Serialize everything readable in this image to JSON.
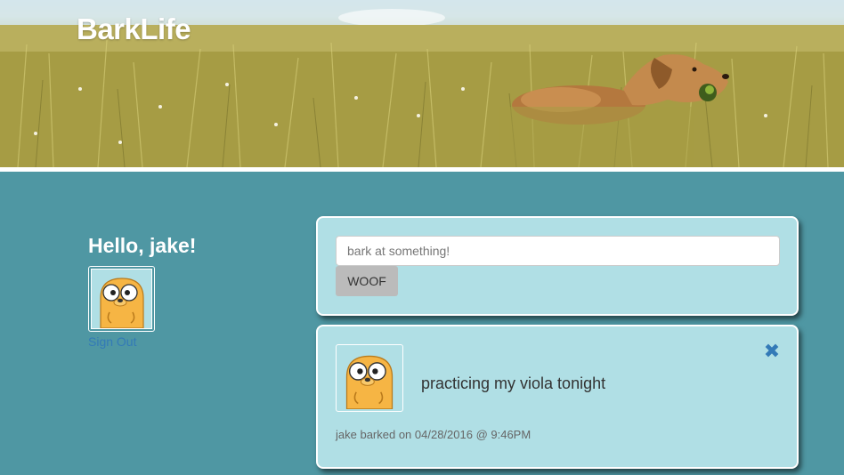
{
  "header": {
    "brand": "BarkLife"
  },
  "sidebar": {
    "greeting": "Hello, jake!",
    "sign_out": "Sign Out"
  },
  "compose": {
    "placeholder": "bark at something!",
    "button_label": "WOOF"
  },
  "posts": [
    {
      "text": "practicing my viola tonight",
      "meta": "jake barked on 04/28/2016 @ 9:46PM",
      "delete_icon": "close-icon"
    }
  ],
  "colors": {
    "page_bg": "#4f97a3",
    "card_bg": "#b0dfe5",
    "link": "#337ab7",
    "button_bg": "#bbbbbb"
  }
}
